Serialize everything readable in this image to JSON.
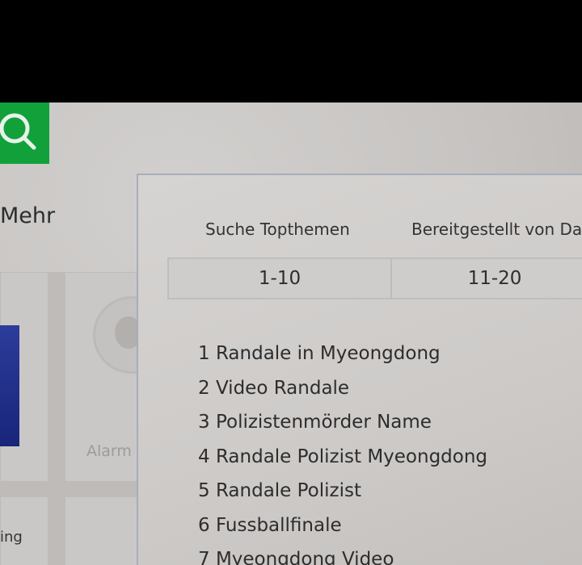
{
  "nav": {
    "more_label": "Mehr"
  },
  "background": {
    "alarm_label": "Alarm",
    "partial_label": "ing"
  },
  "popup": {
    "title_left": "Suche Topthemen",
    "title_right": "Bereitgestellt von Da",
    "tabs": [
      "1-10",
      "11-20"
    ],
    "topics": [
      "1 Randale in Myeongdong",
      "2 Video Randale",
      "3 Polizistenmörder Name",
      "4 Randale Polizist Myeongdong",
      "5 Randale Polizist",
      "6 Fussballfinale",
      "7 Myeongdong Video"
    ]
  },
  "colors": {
    "search_button": "#12a03a",
    "panel_border": "#a7adbb"
  },
  "icons": {
    "search": "search-icon",
    "avatar": "avatar-icon"
  }
}
